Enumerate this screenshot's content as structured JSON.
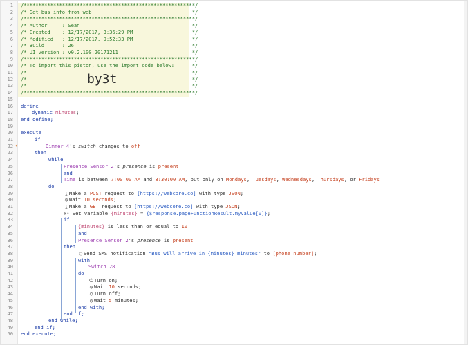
{
  "header_lines": [
    "/**********************************************************/",
    "/* Get bus info from web                                  */",
    "/**********************************************************/",
    "/* Author     : Sean                                      */",
    "/* Created    : 12/17/2017, 3:36:29 PM                    */",
    "/* Modified   : 12/17/2017, 9:52:33 PM                    */",
    "/* Build      : 26                                        */",
    "/* UI version : v0.2.100.20171211                         */",
    "/**********************************************************/",
    "/* To import this piston, use the import code below:      */",
    "/*                                                        */",
    "/*                                                        */",
    "/*                                                        */",
    "/**********************************************************/"
  ],
  "import_code": "by3t",
  "lines": {
    "l16": "define",
    "l17a": "dynamic ",
    "l17b": "minutes",
    "l17c": ";",
    "l18": "end define;",
    "l20": "execute",
    "l21": "if",
    "l22a": "Dimmer 4",
    "l22b": "'s ",
    "l22c": "switch",
    "l22d": " changes to ",
    "l22e": "off",
    "l23": "then",
    "l24": "while",
    "l25a": "Presence Sensor 2",
    "l25b": "'s ",
    "l25c": "presence",
    "l25d": " is ",
    "l25e": "present",
    "l26": "and",
    "l27a": "Time",
    "l27b": " is between ",
    "l27c": "7:00:00 AM",
    "l27d": " and ",
    "l27e": "8:30:00 AM",
    "l27f": ", but only on ",
    "l27g": "Mondays",
    "l27h": ", ",
    "l27i": "Tuesdays",
    "l27j": ", ",
    "l27k": "Wednesdays",
    "l27l": ", ",
    "l27m": "Thursdays",
    "l27n": ", or ",
    "l27o": "Fridays",
    "l28": "do",
    "l29a": "Make a ",
    "l29b": "POST",
    "l29c": " request to ",
    "l29d": "[https://webcore.co]",
    "l29e": " with type ",
    "l29f": "JSON",
    "l29g": ";",
    "l30a": "Wait ",
    "l30b": "10 seconds",
    "l30c": ";",
    "l31a": "Make a ",
    "l31b": "GET",
    "l31c": " request to ",
    "l31d": "[https://webcore.co]",
    "l31e": " with type ",
    "l31f": "JSON",
    "l31g": ";",
    "l32a": "x² Set variable ",
    "l32b": "{minutes}",
    "l32c": " = ",
    "l32d": "{$response.pageFunctionResult.myValue[0]}",
    "l32e": ";",
    "l33": "if",
    "l34a": "{minutes}",
    "l34b": " is less than or equal to ",
    "l34c": "10",
    "l35": "and",
    "l36a": "Presence Sensor 2",
    "l36b": "'s ",
    "l36c": "presence",
    "l36d": " is ",
    "l36e": "present",
    "l37": "then",
    "l38a": "Send SMS notification ",
    "l38b": "\"Bus will arrive in {minutes} minutes\"",
    "l38c": " to ",
    "l38d": "[phone number]",
    "l38e": ";",
    "l39": "with",
    "l40": "Switch 28",
    "l41": "do",
    "l42": "Turn on;",
    "l43a": "Wait ",
    "l43b": "10",
    "l43c": " seconds;",
    "l44": "Turn off;",
    "l45a": "Wait ",
    "l45b": "5",
    "l45c": " minutes;",
    "l46": "end with;",
    "l47": "end if;",
    "l48": "end while;",
    "l49": "end if;",
    "l50": "end execute;"
  },
  "icons": {
    "line_22_marker": "lightning-icon",
    "line_29": "download-icon",
    "line_30": "clock-icon",
    "line_31": "download-icon",
    "line_38": "chat-icon",
    "line_42": "power-icon",
    "line_43": "clock-icon",
    "line_44": "power-off-icon",
    "line_45": "clock-icon"
  },
  "colors": {
    "comment": "#2c7a2c",
    "keyword": "#1f3fa8",
    "variable": "#c04a74",
    "device": "#9d3fb0",
    "string": "#2b5cc2",
    "value": "#c5411f"
  }
}
